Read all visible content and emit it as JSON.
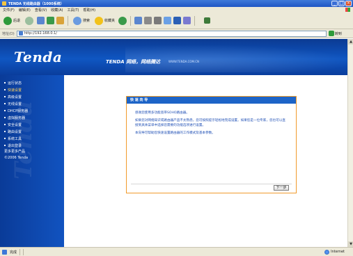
{
  "window": {
    "title": "TENDA 无线路由器（1000系统）",
    "buttons": [
      "_",
      "□",
      "×"
    ]
  },
  "menu": [
    "文件(F)",
    "编辑(E)",
    "查看(V)",
    "收藏(A)",
    "工具(T)",
    "帮助(H)"
  ],
  "toolbar": {
    "back_label": "后退",
    "search_label": "搜索",
    "favorites_label": "收藏夹"
  },
  "address": {
    "label": "地址(D)",
    "url": "http://192.168.0.1/",
    "go_label": "转到"
  },
  "banner": {
    "brand": "Tenda",
    "slogan": "TENDA 网络，网络腾达",
    "site": "WWW.TENDA.COM.CN"
  },
  "sidebar": {
    "items": [
      {
        "label": "运行状态"
      },
      {
        "label": "快速设置"
      },
      {
        "label": "高级设置"
      },
      {
        "label": "无线设置"
      },
      {
        "label": "DHCP服务器"
      },
      {
        "label": "虚拟服务器"
      },
      {
        "label": "安全设置"
      },
      {
        "label": "路由设置"
      },
      {
        "label": "系统工具"
      },
      {
        "label": "退出登录"
      }
    ],
    "more": "更多更多产品",
    "model": "©2006 Tenda"
  },
  "wizard": {
    "title": "快 速 向 导",
    "paragraphs": [
      "感谢您使用多功能宽带SOHO路由器。",
      "如果您对网络知识或路由器产品不太熟悉，您可按照提示轻松地完成设置。如果您是一位专家，您也可以直接到具体菜单中选择您需要的功能选项进行设置。",
      "本向导可帮助您快速设置路由器的工作模式及基本参数。"
    ],
    "next_label": "下一步"
  },
  "status": {
    "text": "完成",
    "zone": "Internet"
  }
}
